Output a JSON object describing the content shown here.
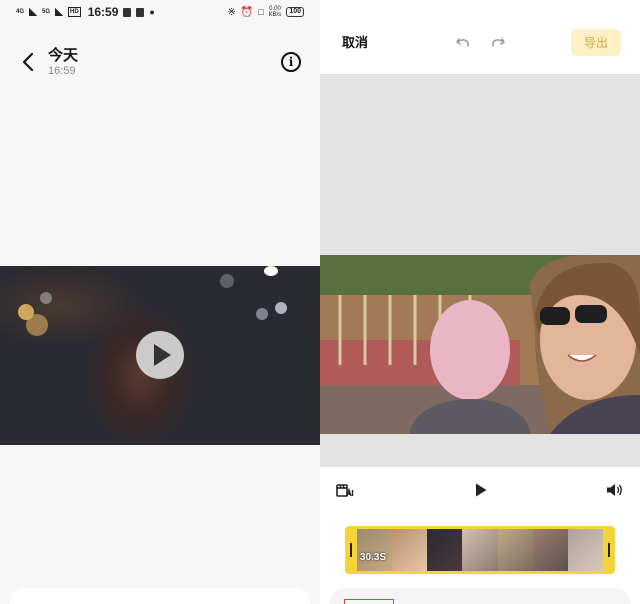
{
  "status_bar": {
    "network_1": "4G",
    "network_2": "5G",
    "hd_badge": "HD",
    "time": "16:59",
    "speed": "0.00\nKB/s",
    "battery": "100"
  },
  "header": {
    "title": "今天",
    "subtitle": "16:59",
    "info_icon_glyph": "i"
  },
  "editor": {
    "cancel_label": "取消",
    "export_label": "导出",
    "duration": "30.3S"
  },
  "colors": {
    "accent_yellow": "#f5d43a",
    "export_bg": "#fdf0c4",
    "export_text": "#c9a949",
    "trim_marker": "#e2443a"
  },
  "icons": {
    "back": "chevron-left-icon",
    "info": "info-circle-icon",
    "play_overlay": "play-icon",
    "undo": "undo-icon",
    "redo": "redo-icon",
    "ai_clip": "ai-clip-icon",
    "play": "play-icon",
    "volume": "volume-icon"
  }
}
